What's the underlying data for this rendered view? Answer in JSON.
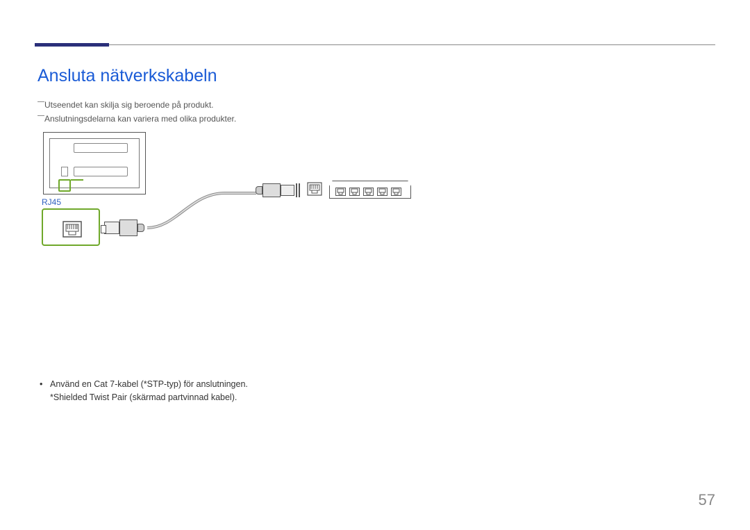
{
  "heading": "Ansluta nätverkskabeln",
  "note1": "Utseendet kan skilja sig beroende på produkt.",
  "note2": "Anslutningsdelarna kan variera med olika produkter.",
  "port_label": "RJ45",
  "bullet": {
    "line1": "Använd en Cat 7-kabel (*STP-typ) för anslutningen.",
    "line2": "*Shielded Twist Pair (skärmad partvinnad kabel)."
  },
  "page_number": "57"
}
